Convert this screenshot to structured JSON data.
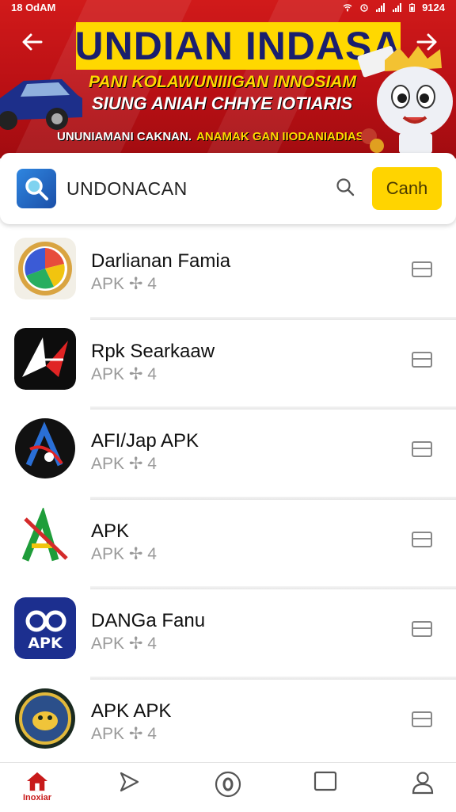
{
  "status_bar": {
    "time": "18 OdAM",
    "clock_right": "9124"
  },
  "banner": {
    "title": "UNDIAN INDASA",
    "line1": "PANI KOLAWUNIIIGAN INNOSIAM",
    "line2": "SIUNG ANIAH CHHYE IOTIARIS",
    "line3a": "UNUNIAMANI CAKNAN.",
    "line3b": "ANAMAK GAN IIODANIADIASI"
  },
  "search": {
    "value": "UNDONACAN",
    "button_label": "Canh"
  },
  "apps": [
    {
      "title": "Darlianan Famia",
      "subtitle": "APK ✢ 4",
      "icon": "rainbow-circle-icon"
    },
    {
      "title": "Rpk Searkaaw",
      "subtitle": "APK ✢ 4",
      "icon": "red-arrow-logo-icon"
    },
    {
      "title": "AFI/Jap APK",
      "subtitle": "APK ✢ 4",
      "icon": "dark-circle-a-icon"
    },
    {
      "title": "APK",
      "subtitle": "APK ✢ 4",
      "icon": "green-a-icon"
    },
    {
      "title": "DANGa Fanu",
      "subtitle": "APK ✢ 4",
      "icon": "blue-apk-icon"
    },
    {
      "title": "APK APK",
      "subtitle": "APK ✢ 4",
      "icon": "seal-icon"
    }
  ],
  "bottom_nav": [
    {
      "label": "Inoxiar",
      "icon": "home-icon",
      "active": true
    },
    {
      "label": "",
      "icon": "send-icon"
    },
    {
      "label": "",
      "icon": "circle-o-icon"
    },
    {
      "label": "",
      "icon": "square-icon"
    },
    {
      "label": "",
      "icon": "profile-icon"
    }
  ],
  "colors": {
    "banner_red": "#c8151a",
    "accent_yellow": "#ffd400",
    "nav_active": "#c81a1a"
  }
}
